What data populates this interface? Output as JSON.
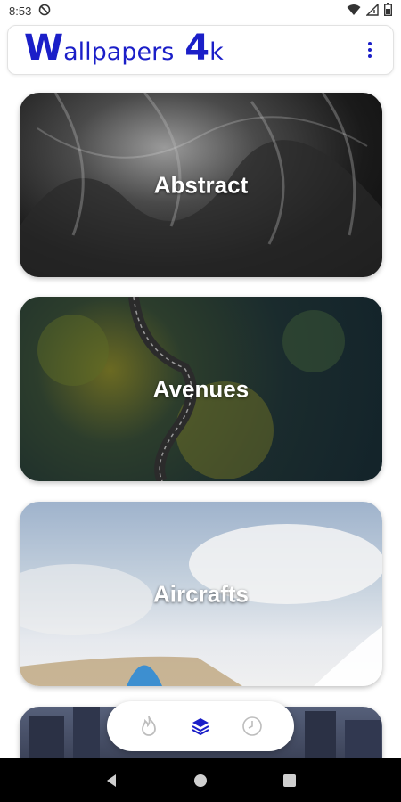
{
  "status_bar": {
    "time": "8:53"
  },
  "app_bar": {
    "title_big_w": "W",
    "title_rest": "allpapers",
    "title_big_4": "4",
    "title_k": "k",
    "accent": "#1b1fc8"
  },
  "categories": [
    {
      "label": "Abstract"
    },
    {
      "label": "Avenues"
    },
    {
      "label": "Aircrafts"
    },
    {
      "label": ""
    }
  ],
  "bottom_nav": {
    "items": [
      "fire-icon",
      "layers-icon",
      "clock-icon"
    ],
    "active": "layers-icon"
  }
}
